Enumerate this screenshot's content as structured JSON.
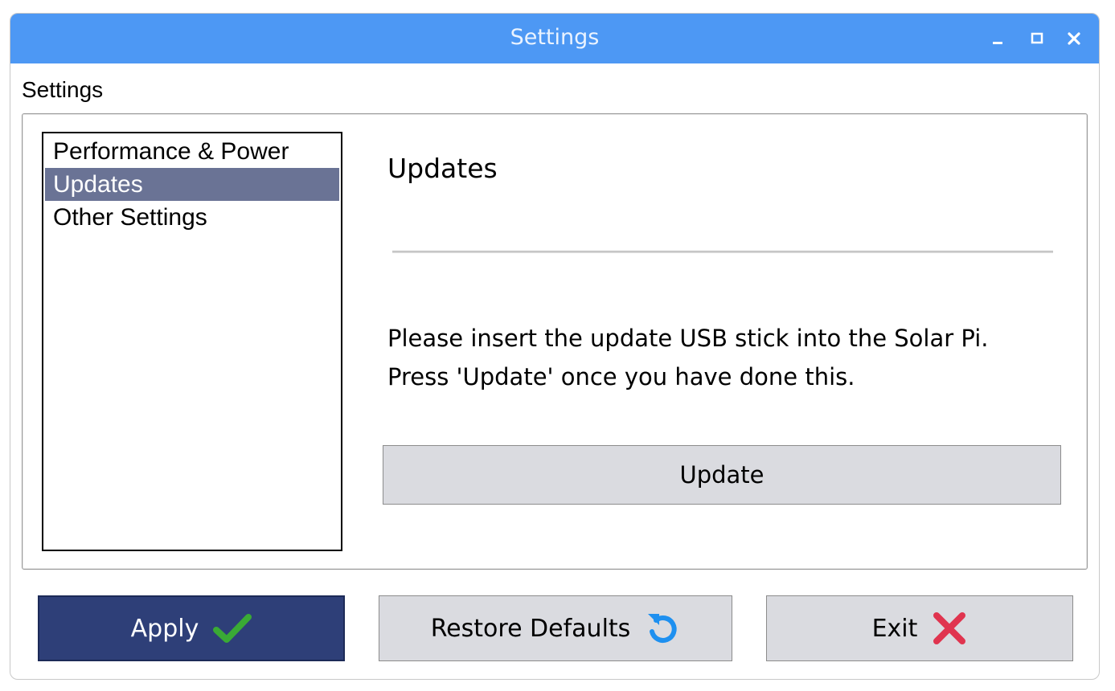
{
  "window": {
    "title": "Settings",
    "controls": [
      "minimize-icon",
      "maximize-icon",
      "close-icon"
    ],
    "titlebar_color": "#4d98f4"
  },
  "section_label": "Settings",
  "sidebar": {
    "items": [
      {
        "label": "Performance & Power",
        "selected": false
      },
      {
        "label": "Updates",
        "selected": true
      },
      {
        "label": "Other Settings",
        "selected": false
      }
    ],
    "selected_color": "#6a7395"
  },
  "main": {
    "title": "Updates",
    "message_line1": "Please insert the update USB stick into the Solar Pi.",
    "message_line2": "Press 'Update' once you have done this.",
    "update_button": "Update"
  },
  "footer": {
    "apply": {
      "label": "Apply",
      "icon": "checkmark-icon",
      "color": "#2e3f78",
      "icon_color": "#3aaa35"
    },
    "restore": {
      "label": "Restore Defaults",
      "icon": "restore-icon",
      "icon_color": "#1e90f0"
    },
    "exit": {
      "label": "Exit",
      "icon": "x-icon",
      "icon_color": "#e0344f"
    }
  }
}
